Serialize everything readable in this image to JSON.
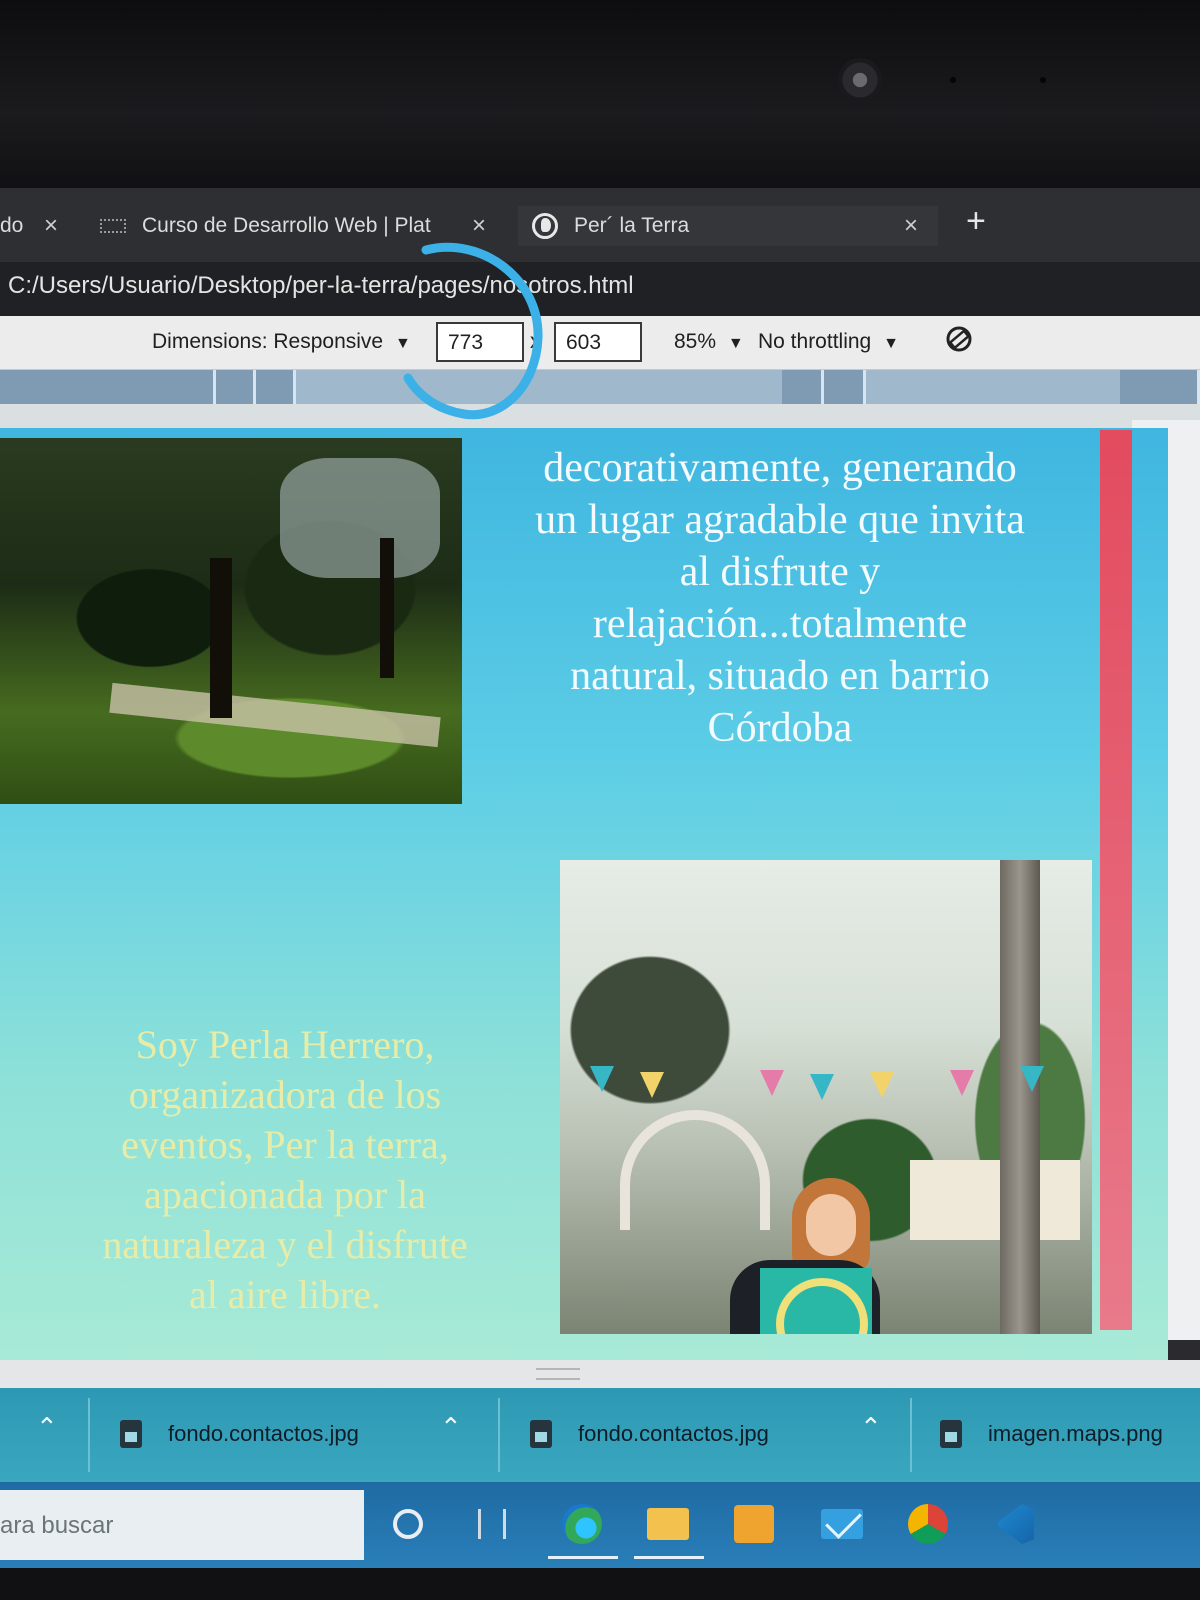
{
  "browser": {
    "tabs": [
      {
        "title": "do",
        "close": "×"
      },
      {
        "title": "Curso de Desarrollo Web | Plat",
        "close": "×",
        "favicon": "platzi-icon"
      },
      {
        "title": "Per´ la Terra",
        "close": "×",
        "favicon": "globe-icon",
        "active": true
      }
    ],
    "new_tab": "+",
    "url": "C:/Users/Usuario/Desktop/per-la-terra/pages/nosotros.html"
  },
  "device_toolbar": {
    "dimensions_label": "Dimensions: Responsive",
    "dimensions_caret": "▼",
    "width": "773",
    "separator": "x",
    "height": "603",
    "zoom": "85%",
    "zoom_caret": "▼",
    "throttling": "No throttling",
    "throttling_caret": "▼"
  },
  "page": {
    "intro_partial": "decorativamente, generando un lugar agradable que invita al disfrute y relajación...totalmente natural, situado en barrio Córdoba",
    "intro_lines": [
      "decorativamente, generando",
      "un lugar agradable que invita",
      "al disfrute y",
      "relajación...totalmente",
      "natural, situado en barrio",
      "Córdoba"
    ],
    "bio_lines": [
      "Soy Perla Herrero,",
      "organizadora de los",
      "eventos, Per la terra,",
      "apacionada por la",
      "naturaleza y el disfrute",
      "al aire libre."
    ],
    "colors": {
      "gradient_top": "#3fb6e0",
      "gradient_bottom": "#a8ead6",
      "accent_strip": "#e34b5f",
      "bio_text": "#e7eda8"
    }
  },
  "downloads": [
    {
      "name": "fondo.contactos.jpg"
    },
    {
      "name": "fondo.contactos.jpg"
    },
    {
      "name": "imagen.maps.png"
    }
  ],
  "taskbar": {
    "search_placeholder": "ara buscar",
    "icons": [
      "cortana-icon",
      "task-view-icon",
      "edge-icon",
      "file-explorer-icon",
      "store-icon",
      "mail-icon",
      "chrome-icon",
      "vscode-icon"
    ]
  }
}
